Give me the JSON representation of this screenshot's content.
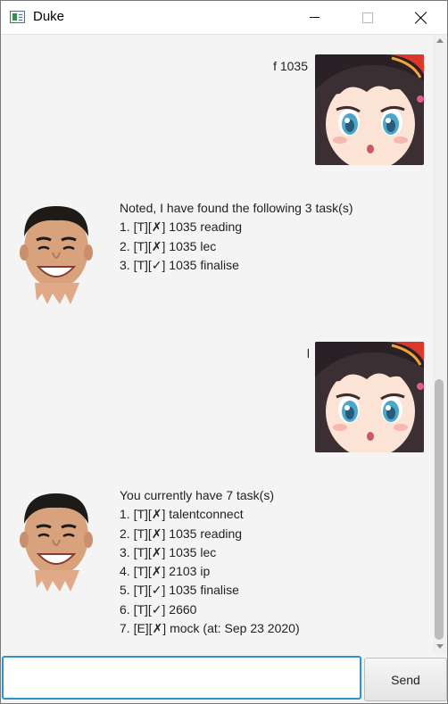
{
  "window": {
    "title": "Duke"
  },
  "messages": [
    {
      "sender": "user",
      "text": "f 1035"
    },
    {
      "sender": "duke",
      "lines": [
        "Noted, I have found the following 3 task(s)",
        "1. [T][✗] 1035 reading",
        "2. [T][✗] 1035 lec",
        "3. [T][✓] 1035 finalise"
      ]
    },
    {
      "sender": "user",
      "text": "l"
    },
    {
      "sender": "duke",
      "lines": [
        "You currently have 7 task(s)",
        "1. [T][✗] talentconnect",
        "2. [T][✗] 1035 reading",
        "3. [T][✗] 1035 lec",
        "4. [T][✗] 2103 ip",
        "5. [T][✓] 1035 finalise",
        "6. [T][✓] 2660",
        "7. [E][✗] mock (at: Sep 23 2020)"
      ]
    }
  ],
  "input": {
    "value": "",
    "placeholder": ""
  },
  "send_button": {
    "label": "Send"
  },
  "colors": {
    "input_focus_border": "#2f93d1",
    "background": "#f4f4f4"
  },
  "icons": {
    "app": "app-window-icon",
    "minimize": "minimize-icon",
    "maximize": "maximize-icon",
    "close": "close-icon",
    "user_avatar": "user-avatar-image",
    "duke_avatar": "duke-avatar-image"
  }
}
